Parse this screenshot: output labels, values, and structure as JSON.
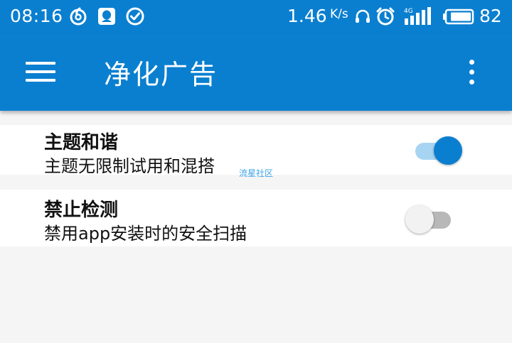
{
  "status_bar": {
    "time": "08:16",
    "left_icons": [
      "netease-music-icon",
      "qq-icon",
      "check-circle-icon"
    ],
    "network_speed": "1.46",
    "network_speed_unit": "K/s",
    "right_icons": [
      "headset-icon",
      "alarm-icon",
      "signal-4g-icon",
      "battery-icon"
    ],
    "network_type": "4G",
    "battery_percent": "82"
  },
  "app_bar": {
    "title": "净化广告",
    "menu_icon": "menu-icon",
    "overflow_icon": "more-vert-icon"
  },
  "settings": [
    {
      "title": "主题和谐",
      "subtitle": "主题无限制试用和混搭",
      "enabled": true
    },
    {
      "title": "禁止检测",
      "subtitle": "禁用app安装时的安全扫描",
      "enabled": false
    }
  ],
  "watermark": "流星社区",
  "colors": {
    "primary": "#0a7fd0",
    "track_on": "#a8d4f3",
    "track_off": "#b8b8b8",
    "thumb_off": "#f2f2f2",
    "background": "#f5f5f5"
  }
}
